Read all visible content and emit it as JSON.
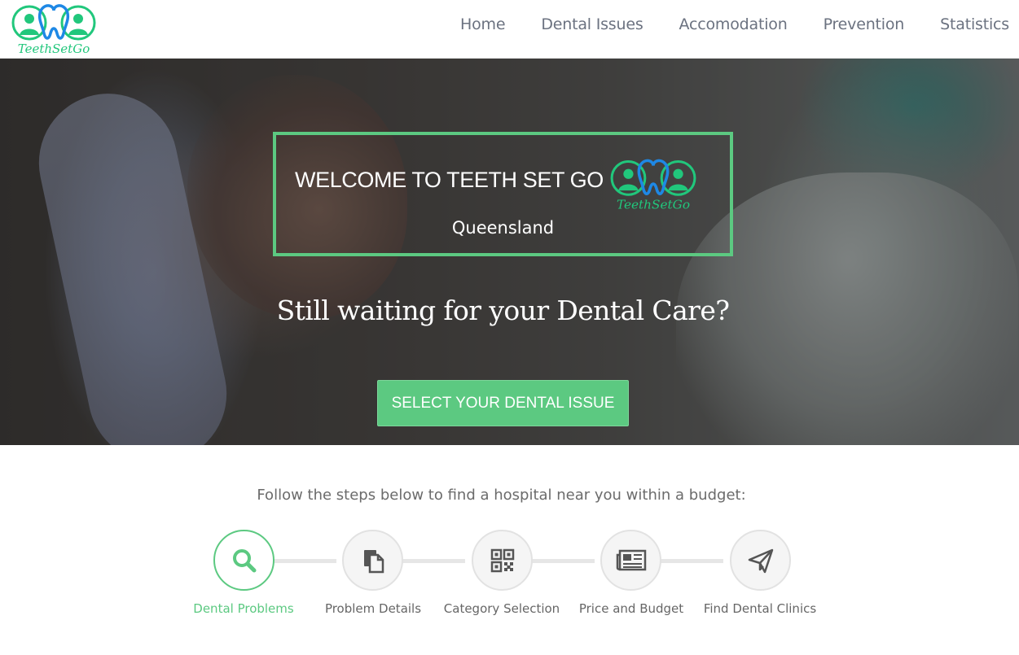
{
  "brand": {
    "logo_text": "TeethSetGo",
    "accent_color": "#5cc981",
    "logo_blue": "#1e88e5",
    "logo_green": "#21c77c"
  },
  "nav": {
    "items": [
      {
        "label": "Home"
      },
      {
        "label": "Dental Issues"
      },
      {
        "label": "Accomodation"
      },
      {
        "label": "Prevention"
      },
      {
        "label": "Statistics"
      }
    ]
  },
  "hero": {
    "welcome_title": "WELCOME TO TEETH SET GO",
    "welcome_subtitle": "Queensland",
    "tagline": "Still waiting for your Dental Care?",
    "cta_label": "SELECT YOUR DENTAL ISSUE"
  },
  "steps": {
    "intro": "Follow the steps below to find a hospital near you within a budget:",
    "items": [
      {
        "label": "Dental Problems",
        "icon": "search-icon",
        "active": true
      },
      {
        "label": "Problem Details",
        "icon": "documents-icon",
        "active": false
      },
      {
        "label": "Category Selection",
        "icon": "qr-code-icon",
        "active": false
      },
      {
        "label": "Price and Budget",
        "icon": "newspaper-icon",
        "active": false
      },
      {
        "label": "Find Dental Clinics",
        "icon": "paper-plane-icon",
        "active": false
      }
    ]
  }
}
